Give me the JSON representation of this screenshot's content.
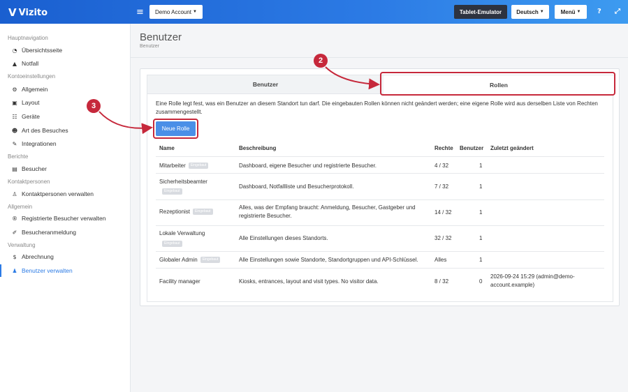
{
  "topbar": {
    "logo_text": "Vizito",
    "account_label": "Demo Account",
    "emulator_label": "Tablet-Emulator",
    "language_label": "Deutsch",
    "menu_label": "Menü",
    "accent_color": "#2c7be5"
  },
  "sidebar": {
    "sections": [
      "Hauptnavigation",
      "Kontoeinstellungen",
      "Berichte",
      "Kontaktpersonen",
      "Allgemein",
      "Verwaltung"
    ],
    "items": [
      {
        "label": "Übersichtsseite",
        "icon": "dashboard-icon"
      },
      {
        "label": "Notfall",
        "icon": "warning-icon"
      },
      {
        "label": "Allgemein",
        "icon": "gear-icon"
      },
      {
        "label": "Layout",
        "icon": "image-icon"
      },
      {
        "label": "Geräte",
        "icon": "sitemap-icon"
      },
      {
        "label": "Art des Besuches",
        "icon": "users-icon"
      },
      {
        "label": "Integrationen",
        "icon": "plug-icon"
      },
      {
        "label": "Besucher",
        "icon": "book-icon"
      },
      {
        "label": "Kontaktpersonen verwalten",
        "icon": "person-icon"
      },
      {
        "label": "Registrierte Besucher verwalten",
        "icon": "registered-icon"
      },
      {
        "label": "Besucheranmeldung",
        "icon": "pen-icon"
      },
      {
        "label": "Abrechnung",
        "icon": "dollar-icon"
      },
      {
        "label": "Benutzer verwalten",
        "icon": "user-cog-icon",
        "active": true
      }
    ]
  },
  "page": {
    "title": "Benutzer",
    "breadcrumb": "Benutzer"
  },
  "tabs": {
    "users": "Benutzer",
    "roles": "Rollen"
  },
  "roles": {
    "description": "Eine Rolle legt fest, was ein Benutzer an diesem Standort tun darf. Die eingebauten Rollen können nicht geändert werden; eine eigene Rolle wird aus derselben Liste von Rechten zusammengestellt.",
    "new_role_label": "Neue Rolle",
    "builtin_badge": "Eingebaut",
    "columns": [
      "Name",
      "Beschreibung",
      "Rechte",
      "Benutzer",
      "Zuletzt geändert"
    ],
    "rows": [
      {
        "name": "Mitarbeiter",
        "builtin": true,
        "description": "Dashboard, eigene Besucher und registrierte Besucher.",
        "rights": "4 / 32",
        "users": "1",
        "modified": ""
      },
      {
        "name": "Sicherheitsbeamter",
        "builtin": true,
        "description": "Dashboard, Notfallliste und Besucherprotokoll.",
        "rights": "7 / 32",
        "users": "1",
        "modified": ""
      },
      {
        "name": "Rezeptionist",
        "builtin": true,
        "description": "Alles, was der Empfang braucht: Anmeldung, Besucher, Gastgeber und registrierte Besucher.",
        "rights": "14 / 32",
        "users": "1",
        "modified": ""
      },
      {
        "name": "Lokale Verwaltung",
        "builtin": true,
        "description": "Alle Einstellungen dieses Standorts.",
        "rights": "32 / 32",
        "users": "1",
        "modified": ""
      },
      {
        "name": "Globaler Admin",
        "builtin": true,
        "description": "Alle Einstellungen sowie Standorte, Standortgruppen und API-Schlüssel.",
        "rights": "Alles",
        "users": "1",
        "modified": ""
      },
      {
        "name": "Facility manager",
        "builtin": false,
        "description": "Kiosks, entrances, layout and visit types. No visitor data.",
        "rights": "8 / 32",
        "users": "0",
        "modified": "2026-09-24 15:29 (admin@demo-account.example)"
      }
    ]
  },
  "annotations": {
    "marker_2": "2",
    "marker_3": "3",
    "highlight_color": "#c6283b"
  }
}
